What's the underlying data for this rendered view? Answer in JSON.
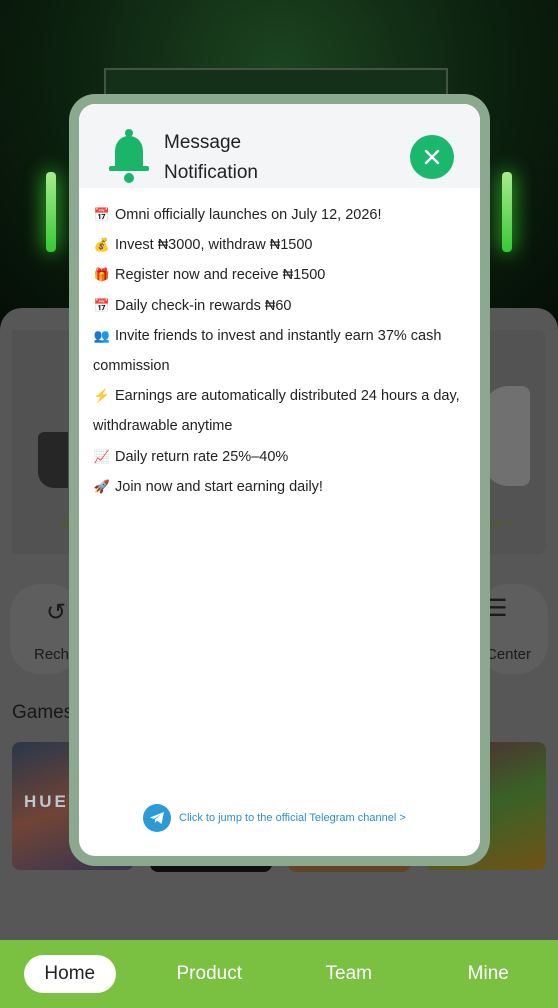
{
  "background": {
    "banner_left_label": "M",
    "banner_right_label": "ce >",
    "quick_left_label": "Rech",
    "quick_right_label": "Center",
    "games_title": "Games",
    "game_tile_text": "HUE"
  },
  "modal": {
    "title_line1": "Message",
    "title_line2": "Notification",
    "close_icon": "close-icon",
    "messages": [
      {
        "icon": "📅",
        "text": "Omni officially launches on July 12, 2026!"
      },
      {
        "icon": "💰",
        "text": "Invest ₦3000, withdraw ₦1500"
      },
      {
        "icon": "🎁",
        "text": "Register now and receive ₦1500"
      },
      {
        "icon": "📅",
        "text": "Daily check-in rewards ₦60"
      },
      {
        "icon": "👥",
        "text": "Invite friends to invest and instantly earn 37% cash commission"
      },
      {
        "icon": "⚡",
        "text": "Earnings are automatically distributed 24 hours a day, withdrawable anytime"
      },
      {
        "icon": "📈",
        "text": "Daily return rate 25%–40%"
      },
      {
        "icon": "🚀",
        "text": "Join now and start earning daily!"
      }
    ],
    "telegram_link": "Click to jump to the official Telegram channel >"
  },
  "nav": {
    "items": [
      "Home",
      "Product",
      "Team",
      "Mine"
    ],
    "active": "Home"
  },
  "colors": {
    "accent_green": "#19b86c",
    "nav_green": "#7ac142",
    "telegram_blue": "#2a9bd6"
  }
}
